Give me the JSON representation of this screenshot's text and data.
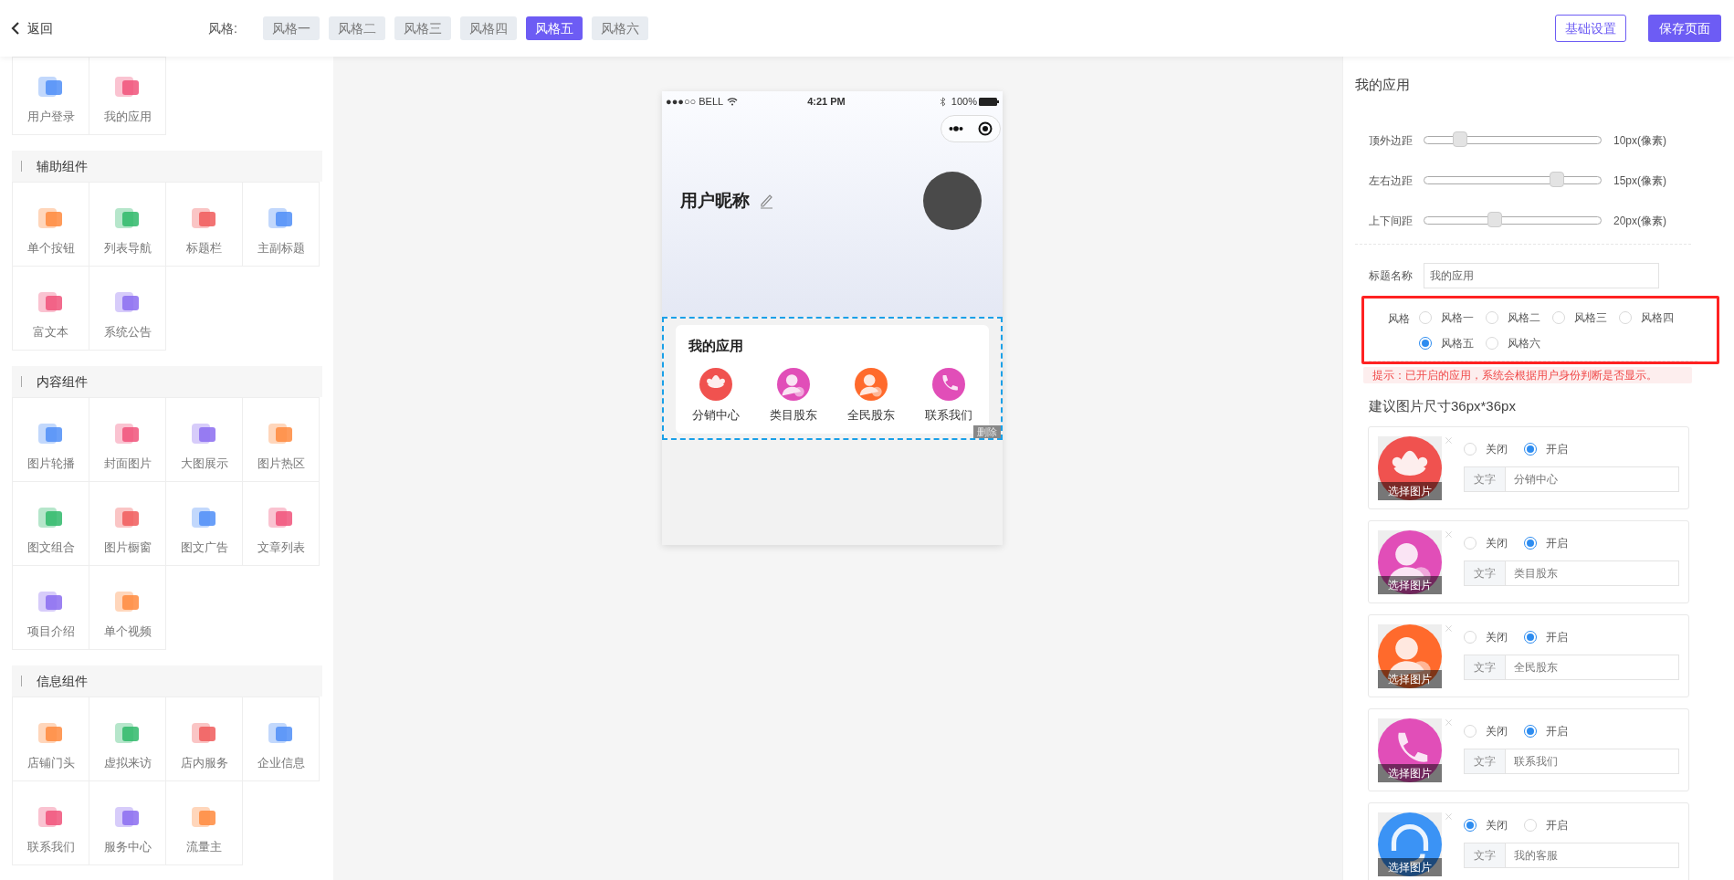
{
  "top_bar": {
    "back": "返回",
    "style_label": "风格:",
    "styles": [
      {
        "label": "风格一",
        "selected": false
      },
      {
        "label": "风格二",
        "selected": false
      },
      {
        "label": "风格三",
        "selected": false
      },
      {
        "label": "风格四",
        "selected": false
      },
      {
        "label": "风格五",
        "selected": true
      },
      {
        "label": "风格六",
        "selected": false
      }
    ],
    "settings_button": "基础设置",
    "save_button": "保存页面"
  },
  "component_panel": {
    "groups": [
      {
        "items": [
          "用户登录",
          "我的应用"
        ]
      },
      {
        "title": "辅助组件",
        "items": [
          "单个按钮",
          "列表导航",
          "标题栏",
          "主副标题",
          "富文本",
          "系统公告"
        ]
      },
      {
        "title": "内容组件",
        "items": [
          "图片轮播",
          "封面图片",
          "大图展示",
          "图片热区",
          "图文组合",
          "图片橱窗",
          "图文广告",
          "文章列表",
          "项目介绍",
          "单个视频"
        ]
      },
      {
        "title": "信息组件",
        "items": [
          "店铺门头",
          "虚拟来访",
          "店内服务",
          "企业信息",
          "联系我们",
          "服务中心",
          "流量主"
        ]
      }
    ]
  },
  "phone": {
    "carrier": "●●●○○ BELL",
    "time": "4:21 PM",
    "battery": "100%",
    "nickname": "用户昵称",
    "card_title": "我的应用",
    "delete": "删除",
    "apps": [
      {
        "label": "分销中心",
        "kind": "group",
        "color": "#f0524f"
      },
      {
        "label": "类目股东",
        "kind": "person",
        "color": "#e14eb8"
      },
      {
        "label": "全民股东",
        "kind": "person",
        "color": "#ff6a2c"
      },
      {
        "label": "联系我们",
        "kind": "phone",
        "color": "#e14eb8"
      }
    ]
  },
  "settings_panel": {
    "title": "我的应用",
    "sliders": [
      {
        "label": "顶外边距",
        "level": 0.2,
        "reading": "10px(像素)"
      },
      {
        "label": "左右边距",
        "level": 0.75,
        "reading": "15px(像素)"
      },
      {
        "label": "上下间距",
        "level": 0.4,
        "reading": "20px(像素)"
      }
    ],
    "title_field": {
      "label": "标题名称",
      "value": "我的应用"
    },
    "style_field": {
      "label": "风格",
      "options": [
        {
          "label": "风格一",
          "selected": false
        },
        {
          "label": "风格二",
          "selected": false
        },
        {
          "label": "风格三",
          "selected": false
        },
        {
          "label": "风格四",
          "selected": false
        },
        {
          "label": "风格五",
          "selected": true
        },
        {
          "label": "风格六",
          "selected": false
        }
      ]
    },
    "notice": "提示：已开启的应用，系统会根据用户身份判断是否显示。",
    "size_hint": "建议图片尺寸36px*36px",
    "apps": [
      {
        "kind": "group",
        "color": "#f0524f",
        "image_label": "选择图片",
        "field_label": "文字",
        "value": "分销中心",
        "options": [
          {
            "label": "关闭",
            "selected": false
          },
          {
            "label": "开启",
            "selected": true
          }
        ]
      },
      {
        "kind": "person",
        "color": "#e14eb8",
        "image_label": "选择图片",
        "field_label": "文字",
        "value": "类目股东",
        "options": [
          {
            "label": "关闭",
            "selected": false
          },
          {
            "label": "开启",
            "selected": true
          }
        ]
      },
      {
        "kind": "person",
        "color": "#ff6a2c",
        "image_label": "选择图片",
        "field_label": "文字",
        "value": "全民股东",
        "options": [
          {
            "label": "关闭",
            "selected": false
          },
          {
            "label": "开启",
            "selected": true
          }
        ]
      },
      {
        "kind": "phone",
        "color": "#e14eb8",
        "image_label": "选择图片",
        "field_label": "文字",
        "value": "联系我们",
        "options": [
          {
            "label": "关闭",
            "selected": false
          },
          {
            "label": "开启",
            "selected": true
          }
        ]
      },
      {
        "kind": "headset",
        "color": "#3b93f5",
        "image_label": "选择图片",
        "field_label": "文字",
        "value": "我的客服",
        "options": [
          {
            "label": "关闭",
            "selected": true
          },
          {
            "label": "开启",
            "selected": false
          }
        ]
      }
    ]
  }
}
